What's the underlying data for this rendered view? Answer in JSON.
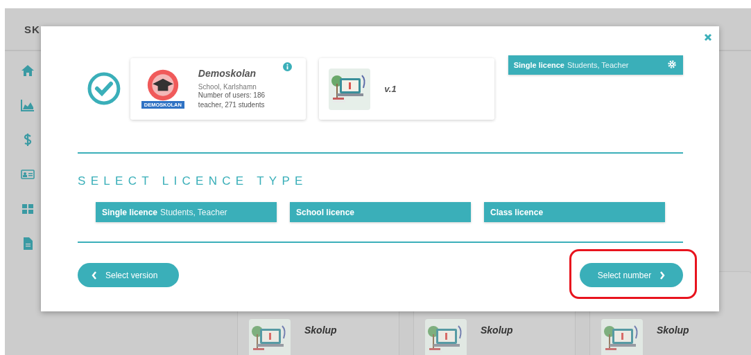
{
  "header": {
    "brand": "SK"
  },
  "background_cards": [
    {
      "title": "Skolup"
    },
    {
      "title": "Skolup"
    },
    {
      "title": "Skolup"
    }
  ],
  "modal": {
    "school": {
      "name": "Demoskolan",
      "badge_text": "DEMOSKOLAN",
      "location": "School, Karlshamn",
      "users": "Number of users: 186 teacher, 271 students"
    },
    "version": {
      "label": "v.1"
    },
    "chosen_licence": {
      "name": "Single licence",
      "detail": "Students, Teacher"
    },
    "section_title": "SELECT LICENCE TYPE",
    "licence_options": [
      {
        "name": "Single licence",
        "detail": "Students, Teacher"
      },
      {
        "name": "School licence"
      },
      {
        "name": "Class licence"
      }
    ],
    "back_button": {
      "label": "Select version"
    },
    "next_button": {
      "label": "Select number",
      "highlighted": true
    }
  }
}
